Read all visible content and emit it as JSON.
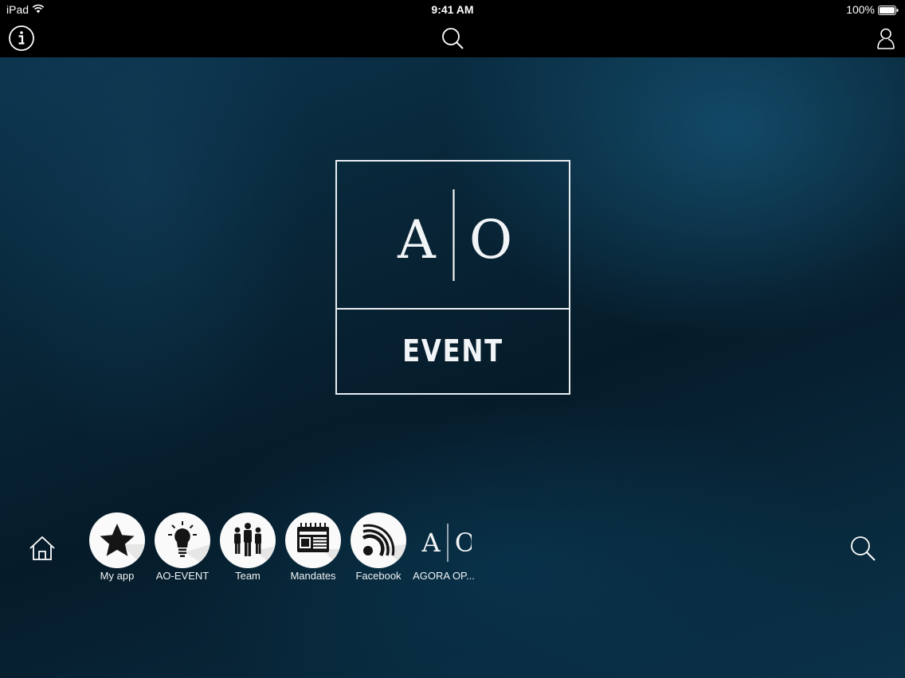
{
  "status_bar": {
    "device": "iPad",
    "time": "9:41 AM",
    "battery": "100%"
  },
  "nav": {
    "left_icon": "info-icon",
    "center_icon": "search-icon",
    "right_icon": "user-icon"
  },
  "logo": {
    "letter_left": "A",
    "letter_right": "O",
    "subtitle": "EVENT"
  },
  "dock": {
    "home_icon": "home-icon",
    "search_icon": "search-icon",
    "items": [
      {
        "label": "My app",
        "icon": "star-icon"
      },
      {
        "label": "AO-EVENT",
        "icon": "lightbulb-icon"
      },
      {
        "label": "Team",
        "icon": "team-icon"
      },
      {
        "label": "Mandates",
        "icon": "newspaper-icon"
      },
      {
        "label": "Facebook",
        "icon": "rss-icon"
      },
      {
        "label": "AGORA OP...",
        "icon": "ao-logo-icon",
        "letter_left": "A",
        "letter_right": "O"
      }
    ]
  },
  "colors": {
    "background_dark": "#061b29",
    "background_light": "#0c3650",
    "foreground": "#ffffff",
    "dock_circle": "#fafafa"
  }
}
